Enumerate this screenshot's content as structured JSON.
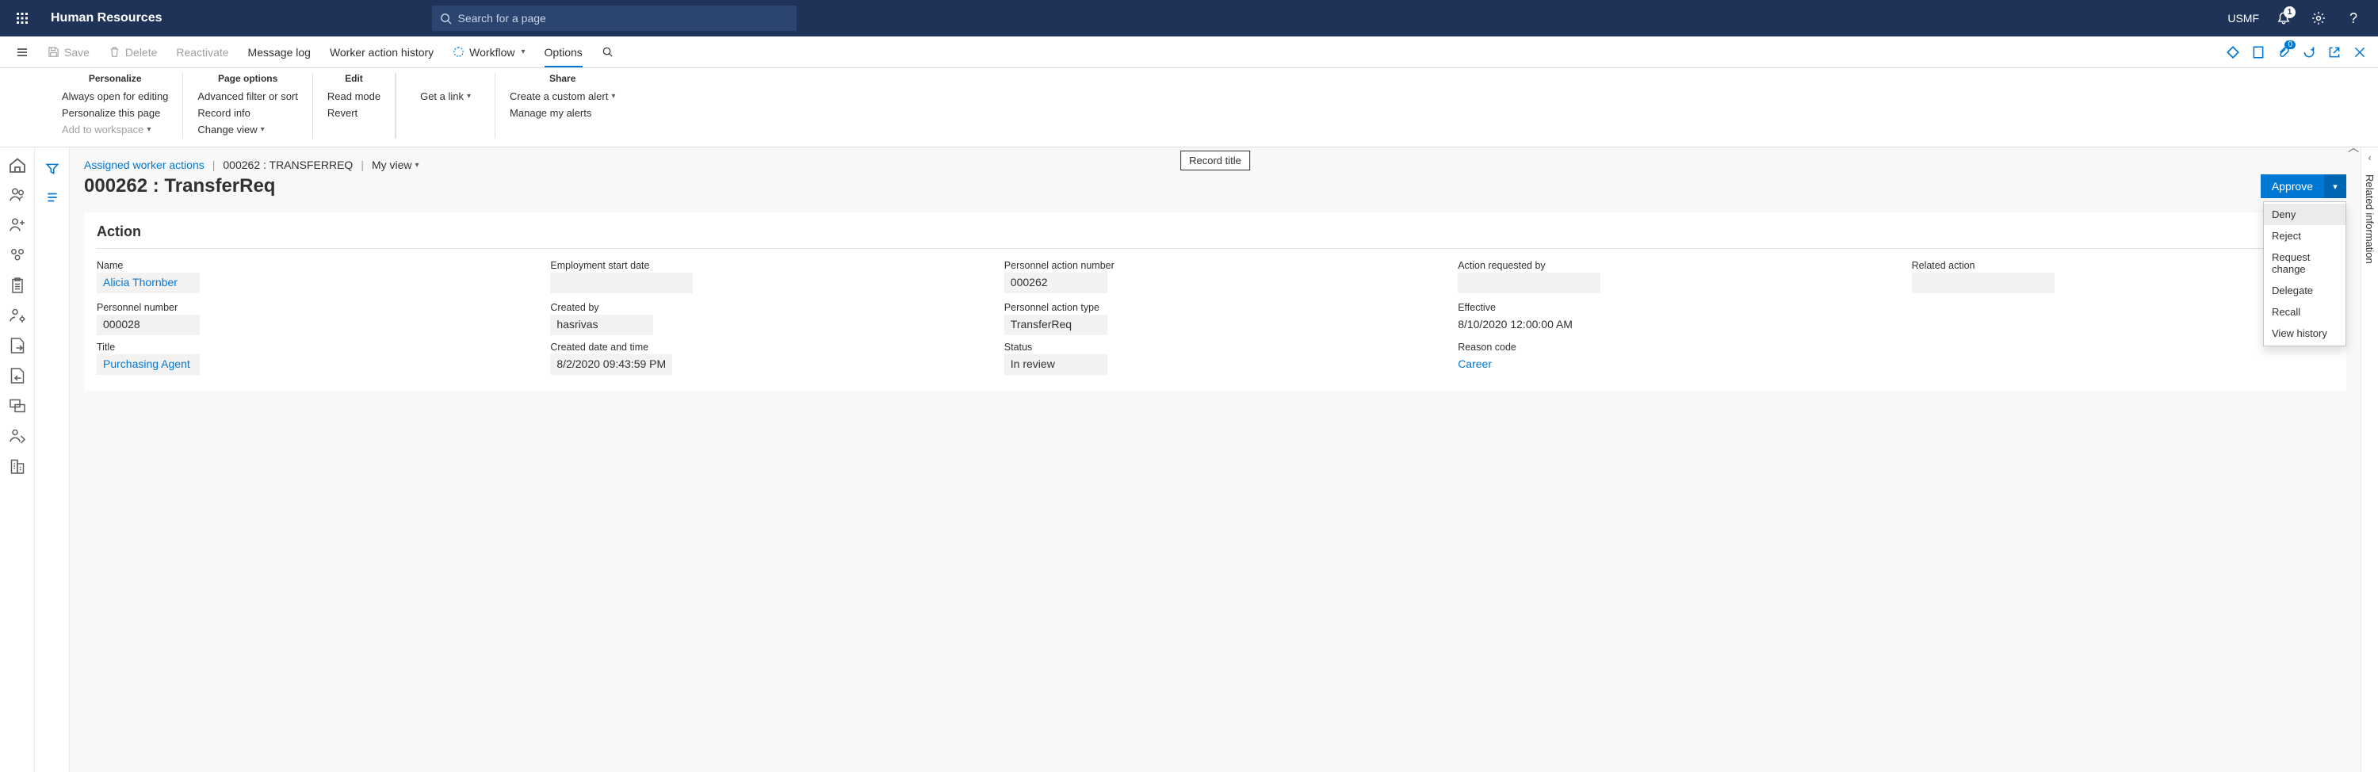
{
  "top": {
    "app_title": "Human Resources",
    "search_placeholder": "Search for a page",
    "company": "USMF",
    "bell_badge": "1"
  },
  "cmdbar": {
    "save": "Save",
    "delete": "Delete",
    "reactivate": "Reactivate",
    "message_log": "Message log",
    "worker_action_history": "Worker action history",
    "workflow": "Workflow",
    "options": "Options",
    "attach_badge": "0"
  },
  "ribbon": {
    "personalize": {
      "title": "Personalize",
      "always_open": "Always open for editing",
      "personalize_page": "Personalize this page",
      "add_workspace": "Add to workspace"
    },
    "page_options": {
      "title": "Page options",
      "adv_filter": "Advanced filter or sort",
      "record_info": "Record info",
      "change_view": "Change view"
    },
    "edit": {
      "title": "Edit",
      "read_mode": "Read mode",
      "revert": "Revert"
    },
    "share": {
      "title": "Share",
      "get_link": "Get a link",
      "create_alert": "Create a custom alert",
      "manage_alerts": "Manage my alerts"
    }
  },
  "crumbs": {
    "assigned": "Assigned worker actions",
    "record": "000262 : TRANSFERREQ",
    "my_view": "My view"
  },
  "page_title": "000262 : TransferReq",
  "record_title_label": "Record title",
  "approve": {
    "label": "Approve",
    "menu": {
      "deny": "Deny",
      "reject": "Reject",
      "request_change": "Request change",
      "delegate": "Delegate",
      "recall": "Recall",
      "view_history": "View history"
    }
  },
  "card": {
    "title": "Action",
    "timestamp": "8/10/2020 12:0",
    "fields": {
      "name_label": "Name",
      "name_value": "Alicia Thornber",
      "emp_start_label": "Employment start date",
      "emp_start_value": "",
      "pan_label": "Personnel action number",
      "pan_value": "000262",
      "req_by_label": "Action requested by",
      "req_by_value": "",
      "related_label": "Related action",
      "related_value": "",
      "pnum_label": "Personnel number",
      "pnum_value": "000028",
      "created_by_label": "Created by",
      "created_by_value": "hasrivas",
      "pat_label": "Personnel action type",
      "pat_value": "TransferReq",
      "effective_label": "Effective",
      "effective_value": "8/10/2020 12:00:00 AM",
      "title_label": "Title",
      "title_value": "Purchasing Agent",
      "created_dt_label": "Created date and time",
      "created_dt_value": "8/2/2020 09:43:59 PM",
      "status_label": "Status",
      "status_value": "In review",
      "reason_label": "Reason code",
      "reason_value": "Career"
    }
  },
  "right_rail": {
    "label": "Related information"
  }
}
